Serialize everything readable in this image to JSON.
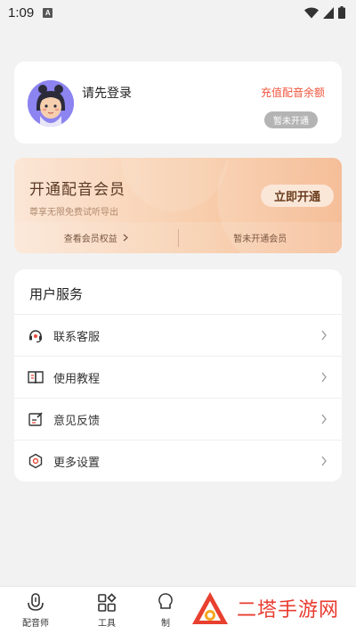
{
  "status_bar": {
    "time": "1:09",
    "notif_letter": "A"
  },
  "login": {
    "prompt": "请先登录",
    "recharge_link": "充值配音余额",
    "status_badge": "暂未开通"
  },
  "vip": {
    "title": "开通配音会员",
    "subtitle": "尊享无限免费试听导出",
    "open_button": "立即开通",
    "benefits_link": "查看会员权益",
    "membership_status": "暂未开通会员"
  },
  "services": {
    "title": "用户服务",
    "items": [
      {
        "label": "联系客服",
        "icon": "headset-icon"
      },
      {
        "label": "使用教程",
        "icon": "book-icon"
      },
      {
        "label": "意见反馈",
        "icon": "feedback-icon"
      },
      {
        "label": "更多设置",
        "icon": "settings-icon"
      }
    ]
  },
  "tabbar": {
    "tabs": [
      {
        "label": "配音师",
        "icon": "microphone-icon"
      },
      {
        "label": "工具",
        "icon": "grid-icon"
      },
      {
        "label": "制",
        "icon": "bulb-icon"
      }
    ]
  },
  "watermark": {
    "text": "二塔手游网"
  },
  "colors": {
    "accent": "#f0553d",
    "watermark": "#e83b2f",
    "vip_text": "#5a3a25"
  }
}
